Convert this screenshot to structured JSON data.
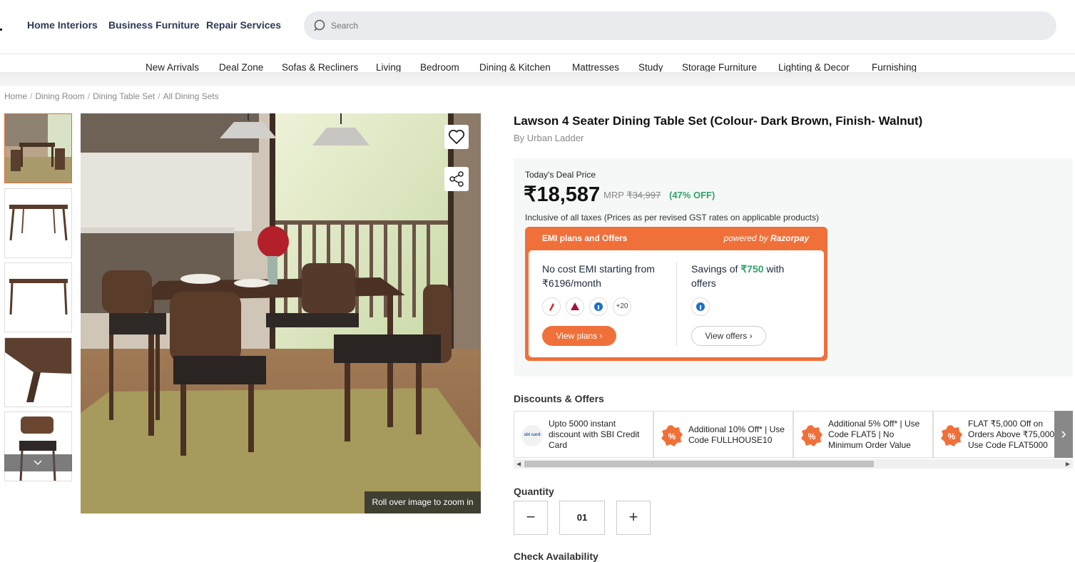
{
  "header": {
    "nav": [
      "Home Interiors",
      "Business Furniture",
      "Repair Services"
    ],
    "search_placeholder": "Search"
  },
  "categories": [
    "New Arrivals",
    "Deal Zone",
    "Sofas & Recliners",
    "Living",
    "Bedroom",
    "Dining & Kitchen",
    "Mattresses",
    "Study",
    "Storage Furniture",
    "Lighting & Decor",
    "Furnishing"
  ],
  "breadcrumb": [
    "Home",
    "Dining Room",
    "Dining Table Set",
    "All Dining Sets"
  ],
  "gallery": {
    "zoom_hint": "Roll over image to zoom in",
    "thumbnail_count": 5
  },
  "product": {
    "title": "Lawson 4 Seater Dining Table Set (Colour- Dark Brown, Finish- Walnut)",
    "brand": "By Urban Ladder",
    "deal_label": "Today's Deal Price",
    "price": "₹18,587",
    "mrp_label": "MRP",
    "mrp": "₹34,997",
    "discount": "(47% OFF)",
    "tax_note": "Inclusive of all taxes (Prices as per revised GST rates on applicable products)"
  },
  "emi": {
    "heading": "EMI plans and Offers",
    "powered_by": "powered by",
    "provider": "Razorpay",
    "emi_line1": "No cost EMI starting from",
    "emi_line2": "₹6196/month",
    "more_banks": "+20",
    "view_plans": "View plans",
    "savings_prefix": "Savings of",
    "savings_amount": "₹750",
    "savings_suffix": "with",
    "savings_line2": "offers",
    "view_offers": "View offers"
  },
  "offers": {
    "title": "Discounts & Offers",
    "items": [
      "Upto 5000 instant discount with SBI Credit Card",
      "Additional 10% Off* | Use Code FULLHOUSE10",
      "Additional 5% Off* | Use Code FLAT5 | No Minimum Order Value",
      "FLAT ₹5,000 Off on Orders Above ₹75,000 | Use Code FLAT5000"
    ],
    "sbi_badge": "sbi card"
  },
  "quantity": {
    "label": "Quantity",
    "value": "01",
    "minus": "−",
    "plus": "+"
  },
  "check_availability": "Check Availability",
  "colors": {
    "accent": "#f0703a",
    "discount_green": "#2ea36b",
    "nav_text": "#2a3a55"
  }
}
